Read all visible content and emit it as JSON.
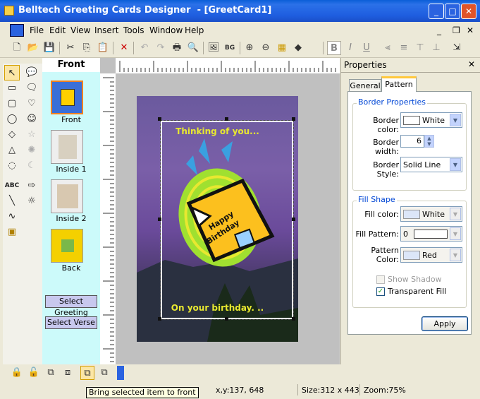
{
  "window": {
    "title": "Belltech Greeting Cards Designer  - [GreetCard1]"
  },
  "caption_buttons": {
    "minimize": "_",
    "maximize": "□",
    "close": "✕"
  },
  "menu": [
    "File",
    "Edit",
    "View",
    "Insert",
    "Tools",
    "Window",
    "Help"
  ],
  "mdi_buttons": {
    "minimize": "_",
    "restore": "❐",
    "close": "✕"
  },
  "pages_panel": {
    "header": "Front",
    "pages": [
      "Front",
      "Inside 1",
      "Inside 2",
      "Back"
    ],
    "select_greeting": "Select Greeting",
    "select_verse": "Select Verse"
  },
  "card": {
    "top_text": "Thinking of you...",
    "bottom_text": "On your birthday. ..",
    "badge_line1": "Happy",
    "badge_line2": "Birthday"
  },
  "properties": {
    "title": "Properties",
    "tabs": [
      "General",
      "Pattern"
    ],
    "active_tab": "Pattern",
    "border_group": "Border Properties",
    "border_color_label": "Border color:",
    "border_color_value": "White",
    "border_width_label": "Border width:",
    "border_width_value": "6",
    "border_style_label": "Border Style:",
    "border_style_value": "Solid Line",
    "fill_group": "Fill Shape",
    "fill_color_label": "Fill color:",
    "fill_color_value": "White",
    "fill_pattern_label": "Fill Pattern:",
    "fill_pattern_value": "0",
    "pattern_color_label_1": "Pattern",
    "pattern_color_label_2": "Color:",
    "pattern_color_value": "Red",
    "show_shadow": "Show Shadow",
    "transparent_fill": "Transparent Fill",
    "apply": "Apply"
  },
  "tooltip": "Bring selected item to front",
  "status": {
    "coords": "x,y:137, 648",
    "size": "Size:312 x 443",
    "zoom": "Zoom:75%"
  },
  "colors": {
    "accent": "#0a5fd8",
    "card_sky": "#6a4a9a",
    "card_text": "#e8e830"
  }
}
